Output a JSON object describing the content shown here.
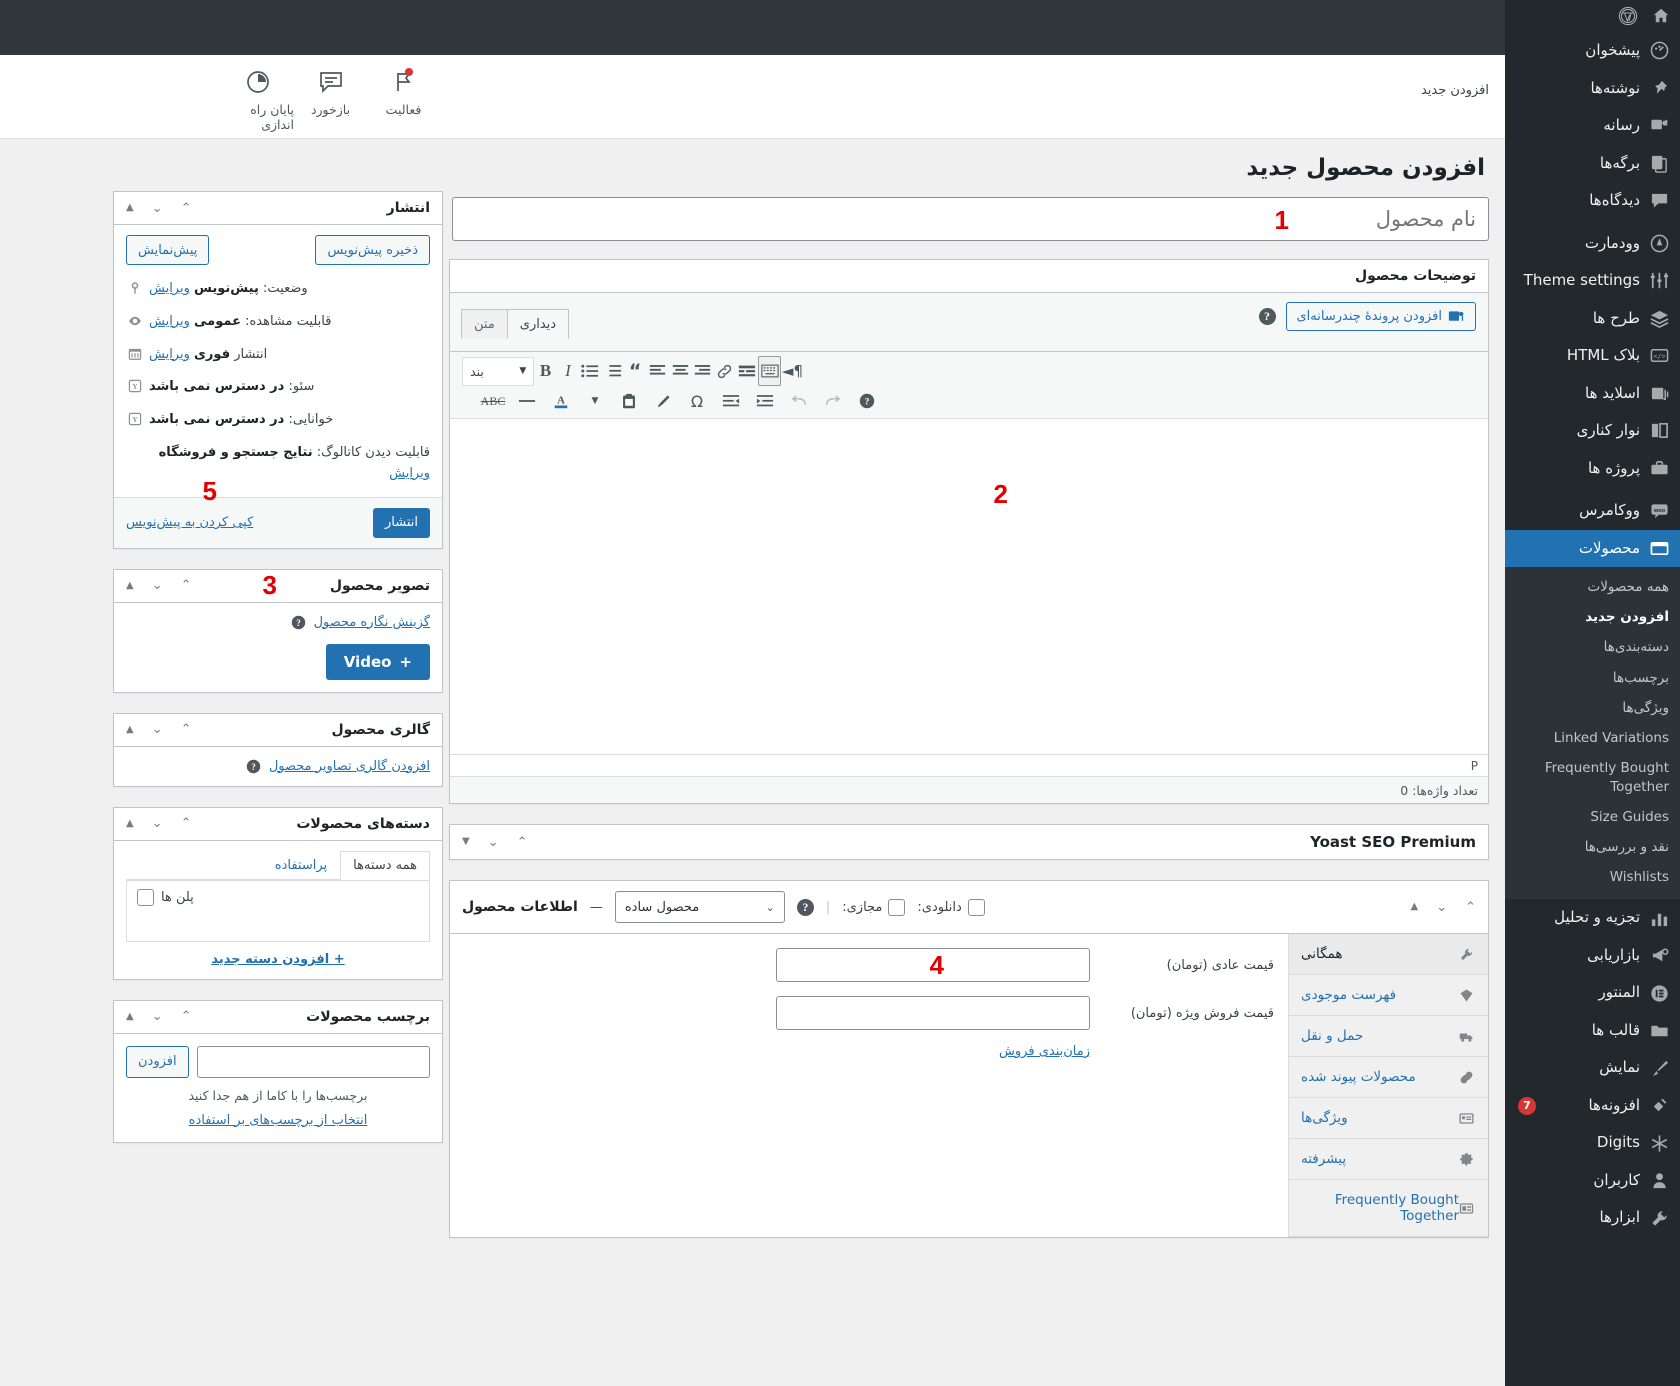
{
  "sidebar": {
    "top_icons": [
      "wordpress-logo",
      "home-icon"
    ],
    "items": [
      {
        "label": "پیشخوان",
        "icon": "dashboard-icon"
      },
      {
        "label": "نوشته‌ها",
        "icon": "pin-icon"
      },
      {
        "label": "رسانه",
        "icon": "media-icon"
      },
      {
        "label": "برگه‌ها",
        "icon": "pages-icon"
      },
      {
        "label": "دیدگاه‌ها",
        "icon": "comments-icon"
      },
      {
        "label": "وودمارت",
        "icon": "woodmart-icon"
      },
      {
        "label": "Theme settings",
        "icon": "sliders-icon"
      },
      {
        "label": "طرح ها",
        "icon": "layers-icon"
      },
      {
        "label": "بلاک HTML",
        "icon": "code-icon"
      },
      {
        "label": "اسلاید ها",
        "icon": "slides-icon"
      },
      {
        "label": "نوار کناری",
        "icon": "sidebar-icon"
      },
      {
        "label": "پروژه ها",
        "icon": "portfolio-icon"
      },
      {
        "label": "ووکامرس",
        "icon": "woo-icon"
      },
      {
        "label": "محصولات",
        "icon": "products-icon",
        "current": true
      },
      {
        "label": "تجزیه و تحلیل",
        "icon": "chart-icon"
      },
      {
        "label": "بازاریابی",
        "icon": "megaphone-icon"
      },
      {
        "label": "المنتور",
        "icon": "elementor-icon"
      },
      {
        "label": "قالب ها",
        "icon": "folder-icon"
      },
      {
        "label": "نمایش",
        "icon": "appearance-icon"
      },
      {
        "label": "افزونه‌ها",
        "icon": "plugin-icon",
        "badge": "7"
      },
      {
        "label": "Digits",
        "icon": "digits-icon"
      },
      {
        "label": "کاربران",
        "icon": "users-icon"
      },
      {
        "label": "ابزارها",
        "icon": "tools-icon"
      }
    ],
    "products_submenu": [
      {
        "label": "همه محصولات"
      },
      {
        "label": "افزودن جدید",
        "current": true
      },
      {
        "label": "دسته‌بندی‌ها"
      },
      {
        "label": "برچسب‌ها"
      },
      {
        "label": "ویژگی‌ها"
      },
      {
        "label": "Linked Variations"
      },
      {
        "label": "Frequently Bought Together"
      },
      {
        "label": "Size Guides"
      },
      {
        "label": "نقد و بررسی‌ها"
      },
      {
        "label": "Wishlists"
      }
    ]
  },
  "topbar": {
    "page_link": "افزودن جدید",
    "tabs": [
      {
        "label": "فعالیت",
        "icon": "flag-icon",
        "dot": true
      },
      {
        "label": "بازخورد",
        "icon": "feedback-icon"
      },
      {
        "label": "پایان راه اندازی",
        "icon": "setup-progress-icon"
      }
    ]
  },
  "page": {
    "heading": "افزودن محصول جدید",
    "title_placeholder": "نام محصول",
    "title_value": ""
  },
  "markers": {
    "m1": "1",
    "m2": "2",
    "m3": "3",
    "m4": "4",
    "m5": "5"
  },
  "editor": {
    "panel_title": "توضیحات محصول",
    "add_media_label": "افزودن پروندهٔ چندرسانه‌ای",
    "tab_visual": "دیداری",
    "tab_text": "متن",
    "format_select": "بند",
    "path": "P",
    "word_count": "تعداد واژه‌ها: 0",
    "toolbar_row1": [
      "paragraph-rtl-icon",
      "keyboard-toolbar-icon",
      "more-tag-icon",
      "link-icon",
      "align-right-icon",
      "align-center-icon",
      "align-left-icon",
      "blockquote-icon",
      "ordered-list-icon",
      "unordered-list-icon",
      "italic-icon",
      "bold-icon"
    ],
    "toolbar_row2": [
      "help-icon",
      "redo-icon",
      "undo-icon",
      "outdent-icon",
      "indent-icon",
      "special-character-icon",
      "clear-formatting-icon",
      "paste-icon",
      "chevron-down-icon",
      "text-color-icon",
      "horizontal-rule-icon",
      "strikethrough-icon"
    ]
  },
  "yoast": {
    "title": "Yoast SEO Premium"
  },
  "product_data": {
    "title": "اطلاعات محصول",
    "dash": "—",
    "type_select": "محصول ساده",
    "virtual_label": "مجازی:",
    "downloadable_label": "دانلودی:",
    "tabs": [
      {
        "label": "همگانی",
        "icon": "wrench-icon",
        "active": true
      },
      {
        "label": "فهرست موجودی",
        "icon": "inventory-icon"
      },
      {
        "label": "حمل و نقل",
        "icon": "shipping-icon"
      },
      {
        "label": "محصولات پیوند شده",
        "icon": "link-icon"
      },
      {
        "label": "ویژگی‌ها",
        "icon": "attributes-icon"
      },
      {
        "label": "پیشرفته",
        "icon": "gear-icon"
      },
      {
        "label": "Frequently Bought Together",
        "icon": "fbt-icon"
      }
    ],
    "fields": [
      {
        "label": "قیمت عادی (تومان)",
        "value": ""
      },
      {
        "label": "قیمت فروش ویژه (تومان)",
        "value": ""
      }
    ],
    "schedule_link": "زمان‌بندی فروش"
  },
  "publish_box": {
    "title": "انتشار",
    "save_draft": "ذخیره پیش‌نویس",
    "preview": "پیش‌نمایش",
    "rows": [
      {
        "icon": "pin-status-icon",
        "prefix": "وضعیت:",
        "value": "پیش‌نویس",
        "edit": "ویرایش"
      },
      {
        "icon": "eye-icon",
        "prefix": "قابلیت مشاهده:",
        "value": "عمومی",
        "edit": "ویرایش"
      },
      {
        "icon": "calendar-icon",
        "prefix": "انتشار",
        "value": "فوری",
        "edit": "ویرایش"
      },
      {
        "icon": "yoast-icon",
        "prefix": "سئو:",
        "value": "در دسترس نمی باشد",
        "edit": ""
      },
      {
        "icon": "yoast-icon",
        "prefix": "خوانایی:",
        "value": "در دسترس نمی باشد",
        "edit": ""
      },
      {
        "icon": "",
        "prefix": "قابلیت دیدن کاتالوگ:",
        "value": "نتایج جستجو و فروشگاه",
        "edit": "ویرایش"
      }
    ],
    "copy_draft": "کپی کردن به پیش‌نویس",
    "publish_button": "انتشار"
  },
  "product_image_box": {
    "title": "تصویر محصول",
    "set_image_link": "گزینش نگاره محصول",
    "video_button": "Video"
  },
  "gallery_box": {
    "title": "گالری محصول",
    "add_gallery_link": "افزودن گالری تصاویر محصول"
  },
  "categories_box": {
    "title": "دسته‌های محصولات",
    "tab_all": "همه دسته‌ها",
    "tab_used": "پراستفاده",
    "items": [
      {
        "label": "پلن ها",
        "checked": false
      }
    ],
    "add_new": "+ افزودن دسته جدید"
  },
  "tags_box": {
    "title": "برچسب محصولات",
    "add_button": "افزودن",
    "input_value": "",
    "hint": "برچسب‌ها را با کاما از هم جدا کنید",
    "choose_link": "انتخاب از برچسب‌های بر استفاده"
  },
  "colors": {
    "accent": "#2271b1",
    "sidebar_bg": "#23282d",
    "submenu_bg": "#2c3338",
    "marker_red": "#e00000",
    "badge_red": "#d63638"
  }
}
